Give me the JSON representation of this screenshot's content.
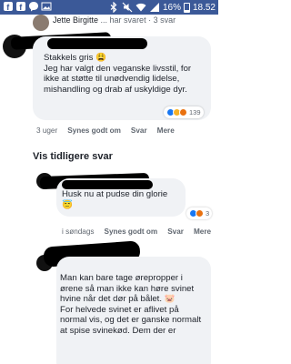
{
  "status_bar": {
    "battery": "16%",
    "time": "18.52"
  },
  "top_line": {
    "name": "Jette Birgitte",
    "rest": "... har svaret · 3 svar"
  },
  "comment1": {
    "text": "Stakkels gris 😩\nJeg har valgt den veganske livsstil, for ikke at støtte til unødvendig lidelse, mishandling og drab af uskyldige dyr.",
    "reaction_count": "139",
    "meta": [
      "3 uger",
      "Synes godt om",
      "Svar",
      "Mere"
    ]
  },
  "section_title": "Vis tidligere svar",
  "comment2": {
    "text": "Husk nu at pudse din glorie 😇",
    "reaction_count": "3",
    "meta": [
      "i søndags",
      "Synes godt om",
      "Svar",
      "Mere"
    ]
  },
  "comment3": {
    "text": "Man kan bare tage ørepropper i ørene så man ikke kan høre svinet hvine når det dør på bålet. 🐷\nFor helvede svinet er aflivet på normal vis, og det er ganske normalt at spise svinekød. Dem der er"
  },
  "colors": {
    "status_bar": "#3b5998",
    "bubble": "#f0f2f5",
    "like": "#1877f2",
    "haha": "#f7b125",
    "angry": "#e9710f"
  }
}
